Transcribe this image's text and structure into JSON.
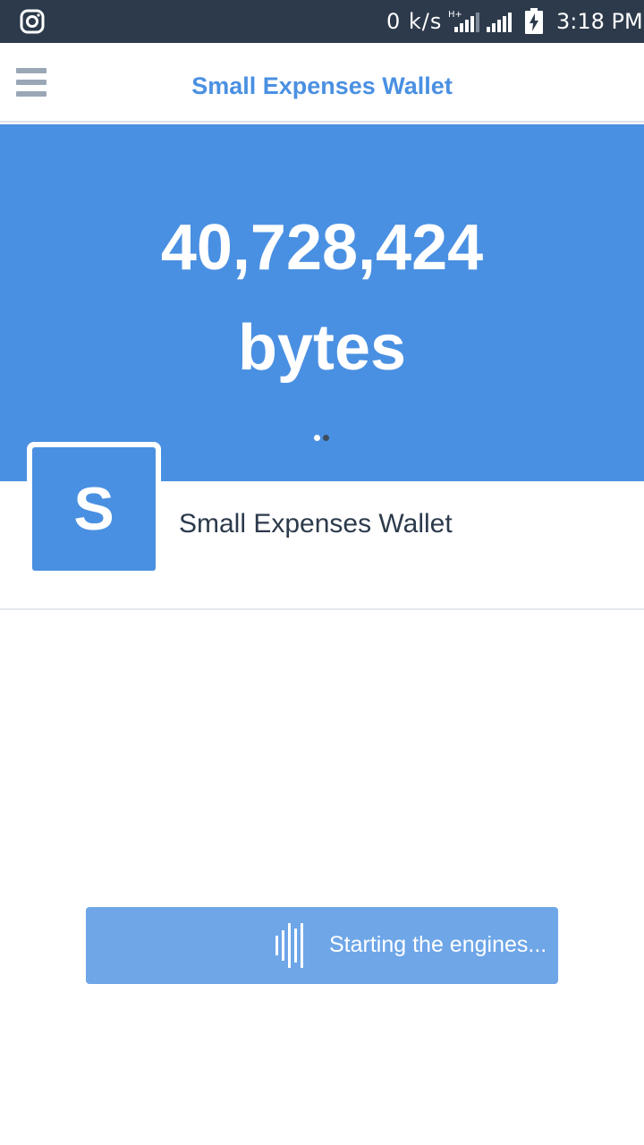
{
  "status_bar": {
    "network_speed": "0 k/s",
    "network_type": "H+",
    "time": "3:18 PM"
  },
  "app_bar": {
    "title": "Small Expenses Wallet",
    "menu_icon": "hamburger-menu-icon"
  },
  "balance": {
    "amount": "40,728,424",
    "unit": "bytes"
  },
  "pager": {
    "page_count": 2,
    "active_index": 0
  },
  "wallet": {
    "avatar_letter": "S",
    "name": "Small Expenses Wallet"
  },
  "action_button": {
    "label": "Starting the engines...",
    "icon": "sound-wave-icon"
  },
  "colors": {
    "accent": "#4a90e2",
    "button_disabled": "#6ea6e8",
    "status_bar": "#2c3a4b",
    "text_dark": "#2c3a4b",
    "menu_icon": "#9aa7b6"
  }
}
